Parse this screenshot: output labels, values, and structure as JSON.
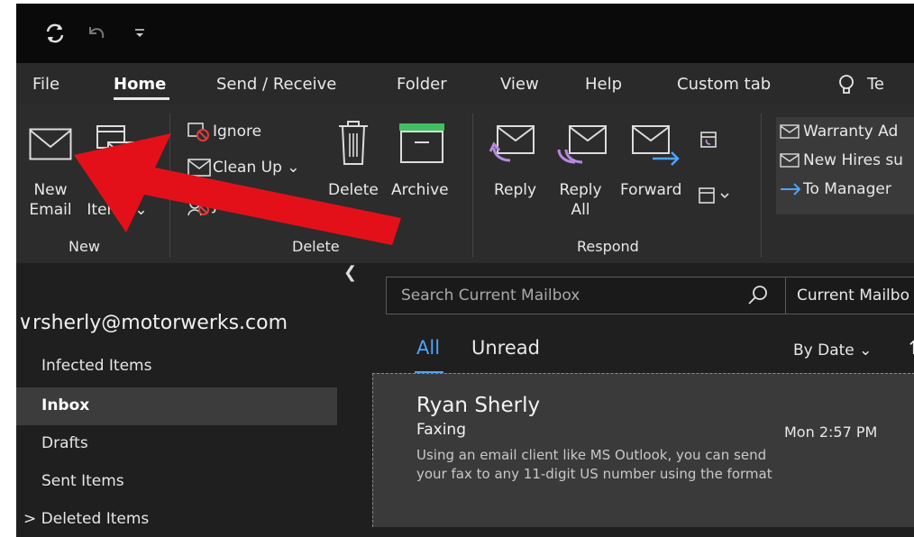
{
  "tabs": [
    "File",
    "Home",
    "Send / Receive",
    "Folder",
    "View",
    "Help",
    "Custom tab",
    "Te"
  ],
  "ribbon": {
    "new_email": [
      "New",
      "Email"
    ],
    "new_items": [
      "New",
      "Items ⌄"
    ],
    "ignore": "Ignore",
    "clean_up": "Clean Up ⌄",
    "junk": "Junk ⌄",
    "delete": "Delete",
    "archive": "Archive",
    "reply": "Reply",
    "reply_all": [
      "Reply",
      "All"
    ],
    "forward": "Forward",
    "groups": {
      "new": "New",
      "delete": "Delete",
      "respond": "Respond"
    },
    "quick_steps": [
      "Warranty Ad",
      "New Hires su",
      "To Manager"
    ]
  },
  "nav": {
    "account": "∨rsherly@motorwerks.com",
    "folders": [
      "Infected Items",
      "Inbox",
      "Drafts",
      "Sent Items",
      "> Deleted Items"
    ]
  },
  "list": {
    "search_placeholder": "Search Current Mailbox",
    "scope": "Current Mailbo",
    "filter_all": "All",
    "filter_unread": "Unread",
    "sort": "By Date ⌄",
    "sort_arrow": "↑",
    "message": {
      "sender": "Ryan Sherly",
      "subject": "Faxing",
      "time": "Mon 2:57 PM",
      "preview": "Using an email client like MS Outlook, you can send your fax to any 11-digit US number using the format"
    }
  },
  "colors": {
    "accent": "#4da3ff",
    "annotation_arrow": "#e3101a"
  }
}
